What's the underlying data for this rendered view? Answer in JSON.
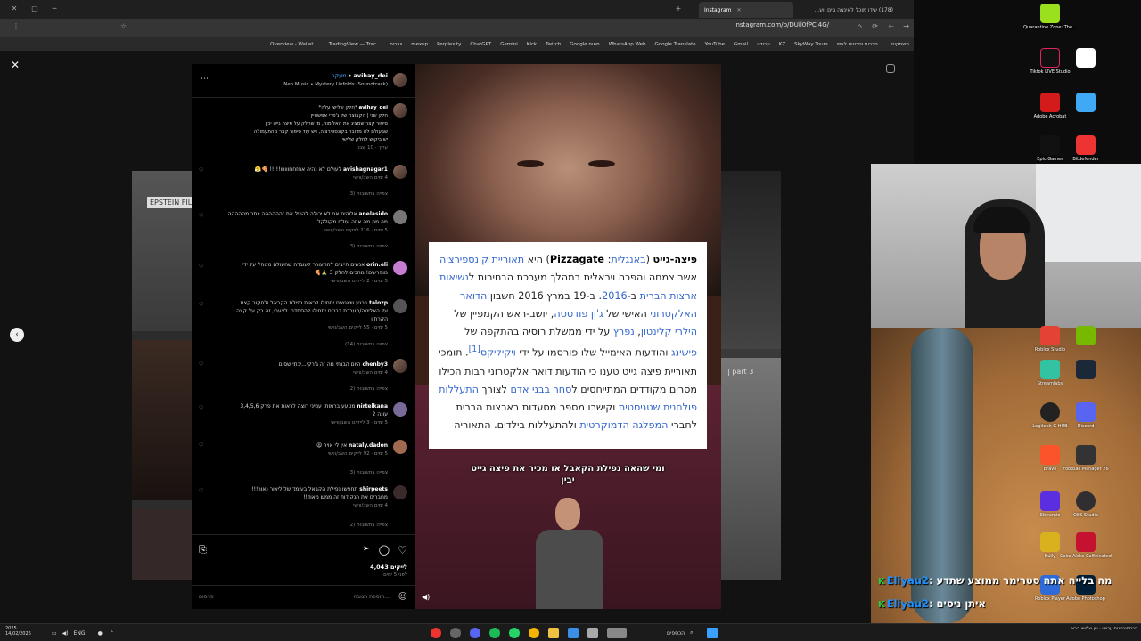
{
  "browser": {
    "tab_active": "Instagram",
    "tab_other": "(178) עידו מוכל לאינצה גיים ווע...",
    "url": "instagram.com/p/DUil0fPCl4G/"
  },
  "bookmarks": [
    "Overview - Wallet ...",
    "TradingView — Trac...",
    "יוצרים",
    "mexup",
    "Perplexity",
    "ChatGPT",
    "Gemini",
    "Kick",
    "Twitch",
    "Google מפות",
    "WhatsApp Web",
    "Google Translate",
    "YouTube",
    "Gmail",
    "עבודה",
    "KZ",
    "SkyWay Tours",
    "סדרות וסרטים לצפי...",
    "משחקים"
  ],
  "post": {
    "author": "avihay_dei",
    "follow_label": "מעקב",
    "audio": "Neo Music • Mystery Unfolds (Soundtrack)",
    "caption": [
      "*חלק שלישי עלה*",
      "חלק שני | הקבוצה של ג'פרי אפשטיין",
      "סיפור קצר שמציג את האלימות, מי שחלק על פיצה גייט יכין",
      "שבעולם לא מדובר בקונספירציה, ויש עוד סיפור קצר מהתעמולה",
      "יש ביקוש לחלק שלישי"
    ],
    "caption_meta": "עריך · 10 שבו'",
    "comments": [
      {
        "user": "avishagnagar1",
        "text": "לעולם לא נהיה אחזחחוווווו!!!!! 🍕😤",
        "meta": "4 ימים",
        "reply": "השב/ווישי",
        "replies": "צפייה בתשובות (3)"
      },
      {
        "user": "anelasido",
        "text": "אלוהים אני לא יכולה להכיל את זהההההה יותר מההההה",
        "text2": "מה מה מה איזה עולם מקולקל",
        "meta": "5 ימים · 216 לייקים",
        "reply": "השב/ווישי",
        "replies": "צפייה בתשובות (3)"
      },
      {
        "user": "orin.eli",
        "text": "אנשים חייבים להתעורר לעובדה שהעולם מנוהל על ידי",
        "text2": "מופרעים! מחכים לחלק 3 🙏🍕",
        "meta": "5 ימים · 2 לייקים",
        "reply": "השב/ווישי",
        "replies": ""
      },
      {
        "user": "talozp",
        "text": "ברגע שאנשים יתחילו לראות נפילת הקבאל ולחקור קצת",
        "text2": "על האליטה/מערכת דברים יתחילו להסתדר. לצערי, זה רק על קצה",
        "text3": "הקרחון",
        "meta": "5 ימים · 55 לייקים",
        "reply": "השב/ווישי",
        "replies": "צפייה בתשובות (14)"
      },
      {
        "user": "chenby3",
        "text": "היום הבנתי מה זה ג'רקי...יכתי שסום",
        "meta": "4 ימים",
        "reply": "השב/ווישי",
        "replies": "צפייה בתשובות (2)"
      },
      {
        "user": "nirtelkana",
        "text": "מטעע ברמות. ענייני רוצה לראות את פרק 3,4,5,6",
        "text2": "עונה 2",
        "meta": "5 ימים · 3 לייקים",
        "reply": "השב/ווישי",
        "replies": ""
      },
      {
        "user": "nataly.dadon",
        "text": "אין לי אויר 😫",
        "meta": "5 ימים · 92 לייקים",
        "reply": "השב/ווישי",
        "replies": "צפייה בתשובות (3)"
      },
      {
        "user": "shirpeets",
        "text": "תחפשו נפילת הקבאל בעומד של ליאור נאור!!!",
        "text2": "מחברים את הנקודות זה ממש מאוד!!",
        "meta": "4 ימים",
        "reply": "השב/ווישי",
        "replies": "צפייה בתשובות (2)"
      }
    ],
    "likes": "4,043 לייקים",
    "date": "לפני 5 ימים",
    "add_comment": "הוספת תגובה...",
    "post_btn": "פרסום"
  },
  "wiki": {
    "html": "<b>פיצה-גייט</b> (<span class='lnk'>באנגלית</span>: <b>Pizzagate</b>) היא <span class='lnk'>תאוריית קונספירציה</span> אשר צמחה והפכה ויראלית במהלך מערכת הבחירות ל<span class='lnk'>נשיאות ארצות הברית</span> ב-<span class='lnk'>2016</span>. ב-19 במרץ 2016 חשבון <span class='lnk'>הדואר האלקטרוני</span> האישי של <span class='lnk'>ג'ון פודסטה</span>, יושב-ראש הקמפיין של <span class='lnk'>הילרי קלינטון</span>, <span class='lnk'>נפרץ</span> על ידי ממשלת רוסיה בהתקפה של <span class='lnk'>פישינג</span> והודעות האימייל שלו פורסמו על ידי <span class='lnk'>ויקיליקס</span><sup class='lnk'>[1]</sup>. תומכי תאוריית פיצה גייט טענו כי הודעות דואר אלקטרוני רבות הכילו מסרים מקודדים המתייחסים ל<span class='lnk'>סחר בבני אדם</span> לצורך <span class='lnk'>התעללות פולחנית שטניסטית</span> וקישרו מספר מסעדות בארצות הברית לחברי <span class='lnk'>המפלגה הדמוקרטית</span> ולהתעללות בילדים. התאוריה"
  },
  "video_caption": [
    "ומי שהאה נפילת הקאבל או מכיר את פיצה גייט",
    "יבין"
  ],
  "bg_labels": {
    "epstein": "EPSTEIN FIL",
    "part3": "| part 3"
  },
  "desktop_icons": [
    "Quarantine Zone: The...",
    "Tiktok LIVE Studio",
    "Adobe Acrobat",
    "Epic Games",
    "Roblox Studio",
    "Streamlabs",
    "Riot Client",
    "Bitdefender",
    "Logitech G HUB",
    "Discord",
    "Brave",
    "Football Manager 26",
    "Streamio",
    "OBS Studio",
    "Bully",
    "Cake Aleks Caffeinated",
    "Roblox Player",
    "Adobe Photoshop"
  ],
  "chat": [
    {
      "user": "Eliyau2",
      "msg": "מה בלייה אתה סטרימר ממוצע שתדע"
    },
    {
      "user": "Eliyau2",
      "msg": "איתן ניסים"
    }
  ],
  "taskbar": {
    "date": "14/02/2026",
    "year": "2025",
    "lang": "ENG",
    "weather": "הכספים",
    "news": "הכספורטנות עכשיו · שן שלישי הבא"
  }
}
